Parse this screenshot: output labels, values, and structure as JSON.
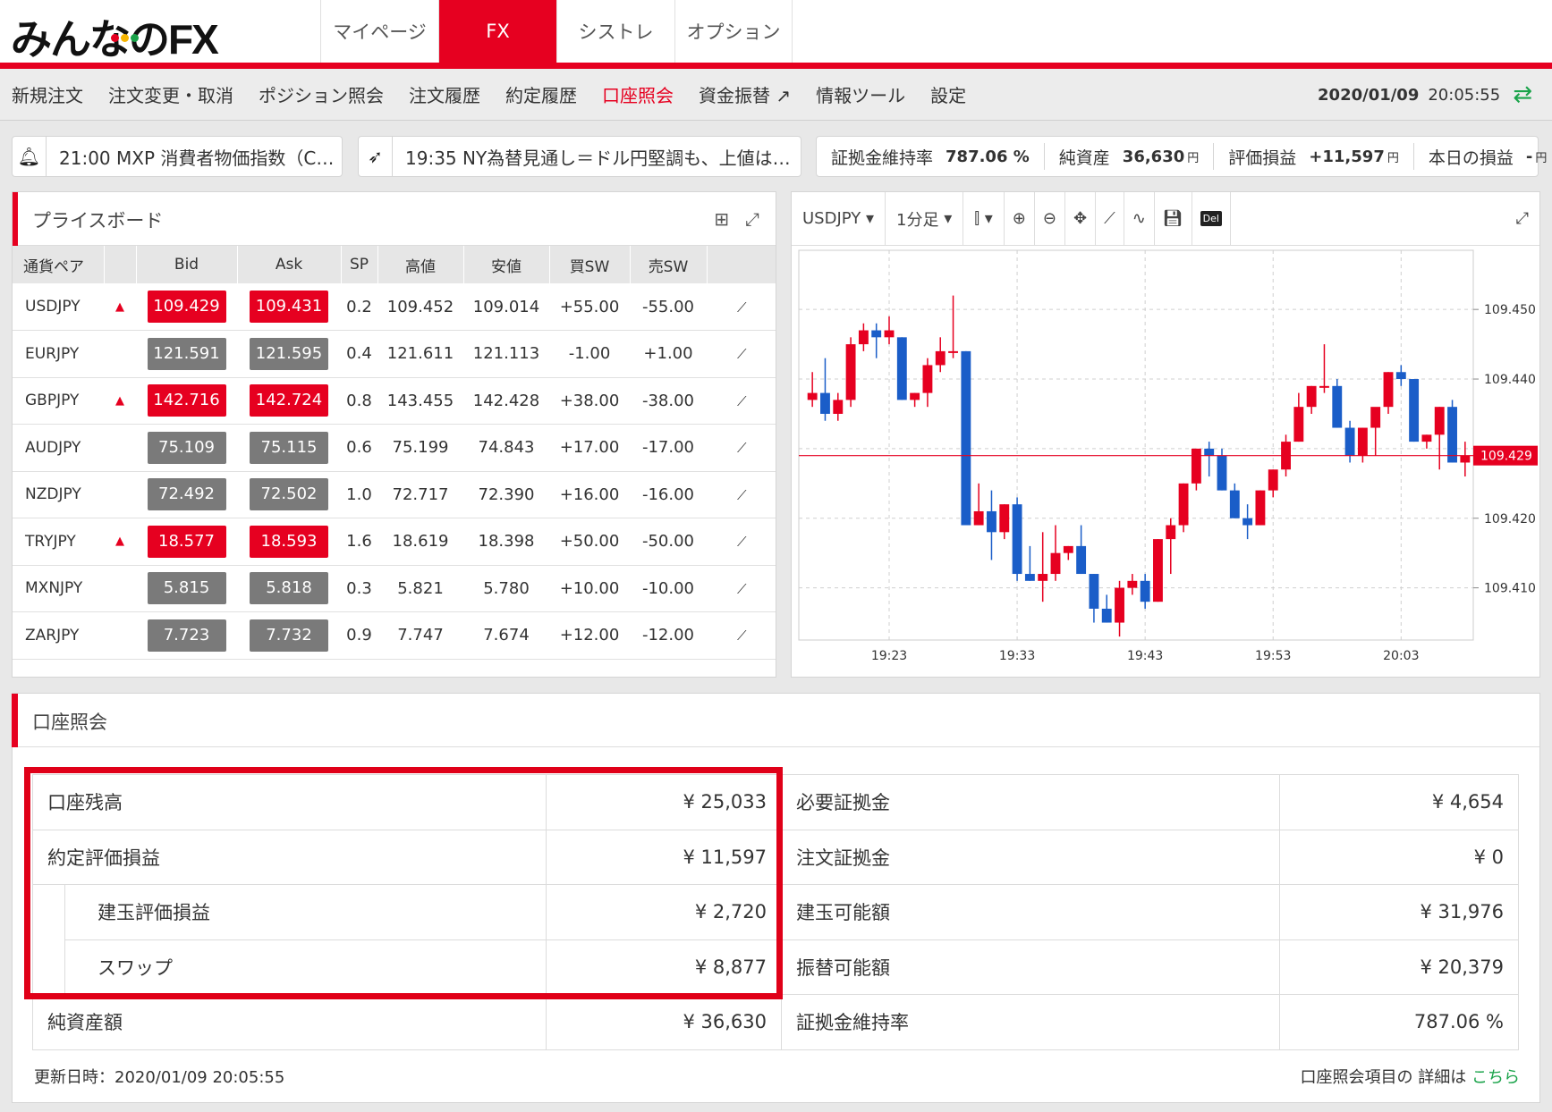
{
  "header": {
    "logo": "みんなのFX",
    "tabs": [
      "マイページ",
      "FX",
      "シストレ",
      "オプション"
    ]
  },
  "subnav": {
    "items": [
      "新規注文",
      "注文変更・取消",
      "ポジション照会",
      "注文履歴",
      "約定履歴",
      "口座照会",
      "資金振替",
      "情報ツール",
      "設定"
    ],
    "date": "2020/01/09",
    "time": "20:05:55"
  },
  "news": {
    "left": "21:00 MXP 消費者物価指数（C…",
    "right": "19:35 NY為替見通し＝ドル円堅調も、上値は…"
  },
  "metrics": {
    "ratio_label": "証拠金維持率",
    "ratio": "787.06 %",
    "net_label": "純資産",
    "net": "36,630",
    "unit": "円",
    "pl_label": "評価損益",
    "pl": "+11,597",
    "today_label": "本日の損益",
    "today": "-"
  },
  "priceboard": {
    "title": "プライスボード",
    "headers": [
      "通貨ペア",
      "",
      "Bid",
      "Ask",
      "SP",
      "高値",
      "安値",
      "買SW",
      "売SW",
      ""
    ],
    "rows": [
      {
        "pair": "USDJPY",
        "up": true,
        "bid": "109.429",
        "ask": "109.431",
        "sp": "0.2",
        "high": "109.452",
        "low": "109.014",
        "buy": "+55.00",
        "sell": "-55.00",
        "hl": true
      },
      {
        "pair": "EURJPY",
        "up": false,
        "bid": "121.591",
        "ask": "121.595",
        "sp": "0.4",
        "high": "121.611",
        "low": "121.113",
        "buy": "-1.00",
        "sell": "+1.00",
        "hl": false
      },
      {
        "pair": "GBPJPY",
        "up": true,
        "bid": "142.716",
        "ask": "142.724",
        "sp": "0.8",
        "high": "143.455",
        "low": "142.428",
        "buy": "+38.00",
        "sell": "-38.00",
        "hl": true
      },
      {
        "pair": "AUDJPY",
        "up": false,
        "bid": "75.109",
        "ask": "75.115",
        "sp": "0.6",
        "high": "75.199",
        "low": "74.843",
        "buy": "+17.00",
        "sell": "-17.00",
        "hl": false
      },
      {
        "pair": "NZDJPY",
        "up": false,
        "bid": "72.492",
        "ask": "72.502",
        "sp": "1.0",
        "high": "72.717",
        "low": "72.390",
        "buy": "+16.00",
        "sell": "-16.00",
        "hl": false
      },
      {
        "pair": "TRYJPY",
        "up": true,
        "bid": "18.577",
        "ask": "18.593",
        "sp": "1.6",
        "high": "18.619",
        "low": "18.398",
        "buy": "+50.00",
        "sell": "-50.00",
        "hl": true
      },
      {
        "pair": "MXNJPY",
        "up": false,
        "bid": "5.815",
        "ask": "5.818",
        "sp": "0.3",
        "high": "5.821",
        "low": "5.780",
        "buy": "+10.00",
        "sell": "-10.00",
        "hl": false
      },
      {
        "pair": "ZARJPY",
        "up": false,
        "bid": "7.723",
        "ask": "7.732",
        "sp": "0.9",
        "high": "7.747",
        "low": "7.674",
        "buy": "+12.00",
        "sell": "-12.00",
        "hl": false
      }
    ]
  },
  "chart_toolbar": {
    "symbol": "USDJPY",
    "interval": "1分足",
    "del": "Del"
  },
  "chart_data": {
    "type": "candlestick",
    "symbol": "USDJPY",
    "interval": "1分足",
    "yticks": [
      109.45,
      109.44,
      109.43,
      109.42,
      109.41
    ],
    "ytick_labels": [
      "109.450",
      "109.440",
      "",
      "109.420",
      "109.410"
    ],
    "ylim": [
      109.4025,
      109.4585
    ],
    "xticks": [
      "19:23",
      "19:33",
      "19:43",
      "19:53",
      "20:03"
    ],
    "current": "109.429",
    "colors": {
      "up": "#e60020",
      "down": "#1a5dc8"
    },
    "candles": [
      [
        109.437,
        109.441,
        109.436,
        109.438
      ],
      [
        109.438,
        109.443,
        109.434,
        109.435
      ],
      [
        109.435,
        109.438,
        109.434,
        109.437
      ],
      [
        109.437,
        109.446,
        109.436,
        109.445
      ],
      [
        109.445,
        109.448,
        109.444,
        109.447
      ],
      [
        109.447,
        109.448,
        109.443,
        109.446
      ],
      [
        109.446,
        109.449,
        109.445,
        109.447
      ],
      [
        109.446,
        109.446,
        109.437,
        109.437
      ],
      [
        109.437,
        109.438,
        109.436,
        109.438
      ],
      [
        109.438,
        109.443,
        109.436,
        109.442
      ],
      [
        109.442,
        109.446,
        109.441,
        109.444
      ],
      [
        109.444,
        109.452,
        109.443,
        109.444
      ],
      [
        109.444,
        109.444,
        109.419,
        109.419
      ],
      [
        109.419,
        109.425,
        109.419,
        109.421
      ],
      [
        109.421,
        109.424,
        109.414,
        109.418
      ],
      [
        109.418,
        109.422,
        109.417,
        109.422
      ],
      [
        109.422,
        109.423,
        109.411,
        109.412
      ],
      [
        109.412,
        109.416,
        109.411,
        109.411
      ],
      [
        109.411,
        109.418,
        109.408,
        109.412
      ],
      [
        109.412,
        109.419,
        109.411,
        109.415
      ],
      [
        109.415,
        109.416,
        109.414,
        109.416
      ],
      [
        109.416,
        109.419,
        109.412,
        109.412
      ],
      [
        109.412,
        109.412,
        109.405,
        109.407
      ],
      [
        109.407,
        109.409,
        109.405,
        109.405
      ],
      [
        109.405,
        109.411,
        109.403,
        109.41
      ],
      [
        109.41,
        109.412,
        109.409,
        109.411
      ],
      [
        109.411,
        109.412,
        109.407,
        109.408
      ],
      [
        109.408,
        109.417,
        109.408,
        109.417
      ],
      [
        109.417,
        109.42,
        109.412,
        109.419
      ],
      [
        109.419,
        109.425,
        109.418,
        109.425
      ],
      [
        109.425,
        109.43,
        109.424,
        109.43
      ],
      [
        109.43,
        109.431,
        109.426,
        109.429
      ],
      [
        109.429,
        109.43,
        109.424,
        109.424
      ],
      [
        109.424,
        109.425,
        109.42,
        109.42
      ],
      [
        109.42,
        109.422,
        109.417,
        109.419
      ],
      [
        109.419,
        109.424,
        109.419,
        109.424
      ],
      [
        109.424,
        109.427,
        109.423,
        109.427
      ],
      [
        109.427,
        109.432,
        109.426,
        109.431
      ],
      [
        109.431,
        109.438,
        109.431,
        109.436
      ],
      [
        109.436,
        109.439,
        109.435,
        109.439
      ],
      [
        109.439,
        109.445,
        109.438,
        109.439
      ],
      [
        109.439,
        109.44,
        109.433,
        109.433
      ],
      [
        109.433,
        109.434,
        109.428,
        109.429
      ],
      [
        109.429,
        109.433,
        109.428,
        109.433
      ],
      [
        109.433,
        109.434,
        109.429,
        109.436
      ],
      [
        109.436,
        109.441,
        109.435,
        109.441
      ],
      [
        109.441,
        109.442,
        109.439,
        109.44
      ],
      [
        109.44,
        109.44,
        109.431,
        109.431
      ],
      [
        109.431,
        109.432,
        109.43,
        109.432
      ],
      [
        109.432,
        109.436,
        109.427,
        109.436
      ],
      [
        109.436,
        109.437,
        109.428,
        109.428
      ],
      [
        109.428,
        109.431,
        109.426,
        109.429
      ]
    ]
  },
  "account": {
    "title": "口座照会",
    "left": [
      {
        "label": "口座残高",
        "value": "¥ 25,033",
        "indent": false
      },
      {
        "label": "約定評価損益",
        "value": "¥ 11,597",
        "indent": false
      },
      {
        "label": "建玉評価損益",
        "value": "¥ 2,720",
        "indent": true
      },
      {
        "label": "スワップ",
        "value": "¥ 8,877",
        "indent": true
      },
      {
        "label": "純資産額",
        "value": "¥ 36,630",
        "indent": false
      }
    ],
    "right": [
      {
        "label": "必要証拠金",
        "value": "¥ 4,654"
      },
      {
        "label": "注文証拠金",
        "value": "¥ 0"
      },
      {
        "label": "建玉可能額",
        "value": "¥ 31,976"
      },
      {
        "label": "振替可能額",
        "value": "¥ 20,379"
      },
      {
        "label": "証拠金維持率",
        "value": "787.06 %"
      }
    ],
    "updated": "更新日時：2020/01/09 20:05:55",
    "help": "口座照会項目の 詳細は",
    "help_link": "こちら"
  }
}
